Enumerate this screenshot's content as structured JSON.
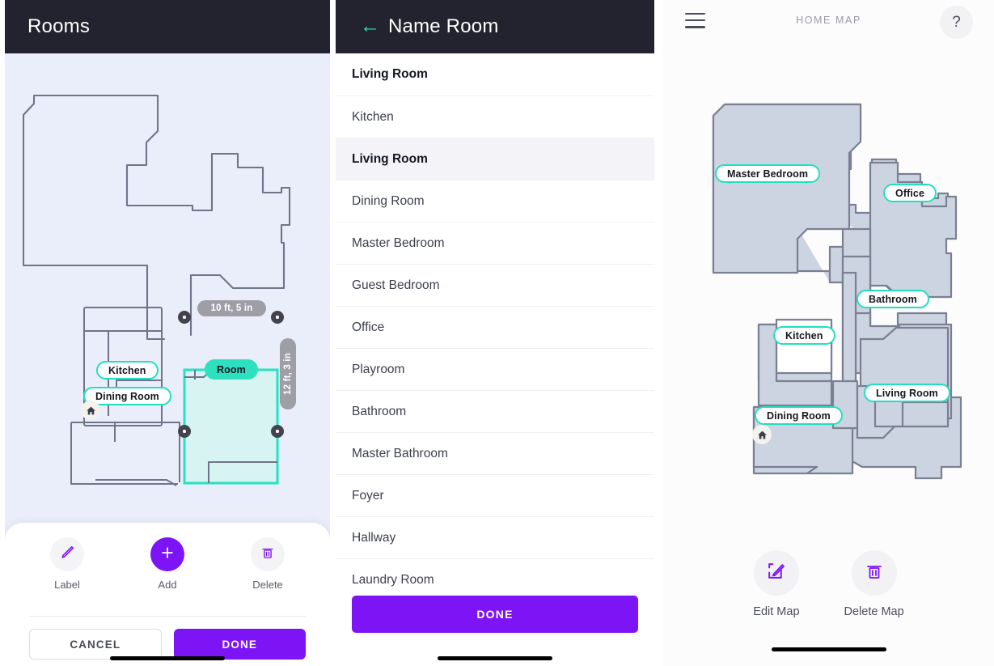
{
  "panel_rooms": {
    "title": "Rooms",
    "plan_labels": [
      {
        "name": "Kitchen",
        "style": "outline"
      },
      {
        "name": "Dining Room",
        "style": "outline"
      },
      {
        "name": "Room",
        "style": "solid"
      }
    ],
    "dimensions": {
      "width_label": "10 ft, 5 in",
      "height_label": "12 ft, 3 in"
    },
    "tools": [
      {
        "label": "Label",
        "icon": "pencil-icon"
      },
      {
        "label": "Add",
        "icon": "plus-icon"
      },
      {
        "label": "Delete",
        "icon": "trash-icon"
      }
    ],
    "actions": {
      "cancel": "CANCEL",
      "done": "DONE"
    }
  },
  "panel_name_room": {
    "title": "Name Room",
    "back_icon": "back-arrow-icon",
    "current_value": "Living Room",
    "options": [
      "Kitchen",
      "Living Room",
      "Dining Room",
      "Master Bedroom",
      "Guest Bedroom",
      "Office",
      "Playroom",
      "Bathroom",
      "Master Bathroom",
      "Foyer",
      "Hallway",
      "Laundry Room"
    ],
    "selected_option": "Living Room",
    "done_label": "DONE"
  },
  "panel_home_map": {
    "title": "HOME MAP",
    "menu_icon": "hamburger-icon",
    "help_icon": "question-mark-icon",
    "map_labels": [
      "Master Bedroom",
      "Office",
      "Bathroom",
      "Kitchen",
      "Living Room",
      "Dining Room"
    ],
    "tools": [
      {
        "label": "Edit Map",
        "icon": "edit-square-icon"
      },
      {
        "label": "Delete Map",
        "icon": "trash-icon"
      }
    ]
  },
  "colors": {
    "header_dark": "#23232f",
    "accent_purple": "#7d14f5",
    "accent_teal": "#21e0bf",
    "plan_background": "#eaeefa",
    "map_fill": "#ccd4e2",
    "map_stroke": "#7a7f92",
    "dimension_pill": "#9e9fa6"
  }
}
